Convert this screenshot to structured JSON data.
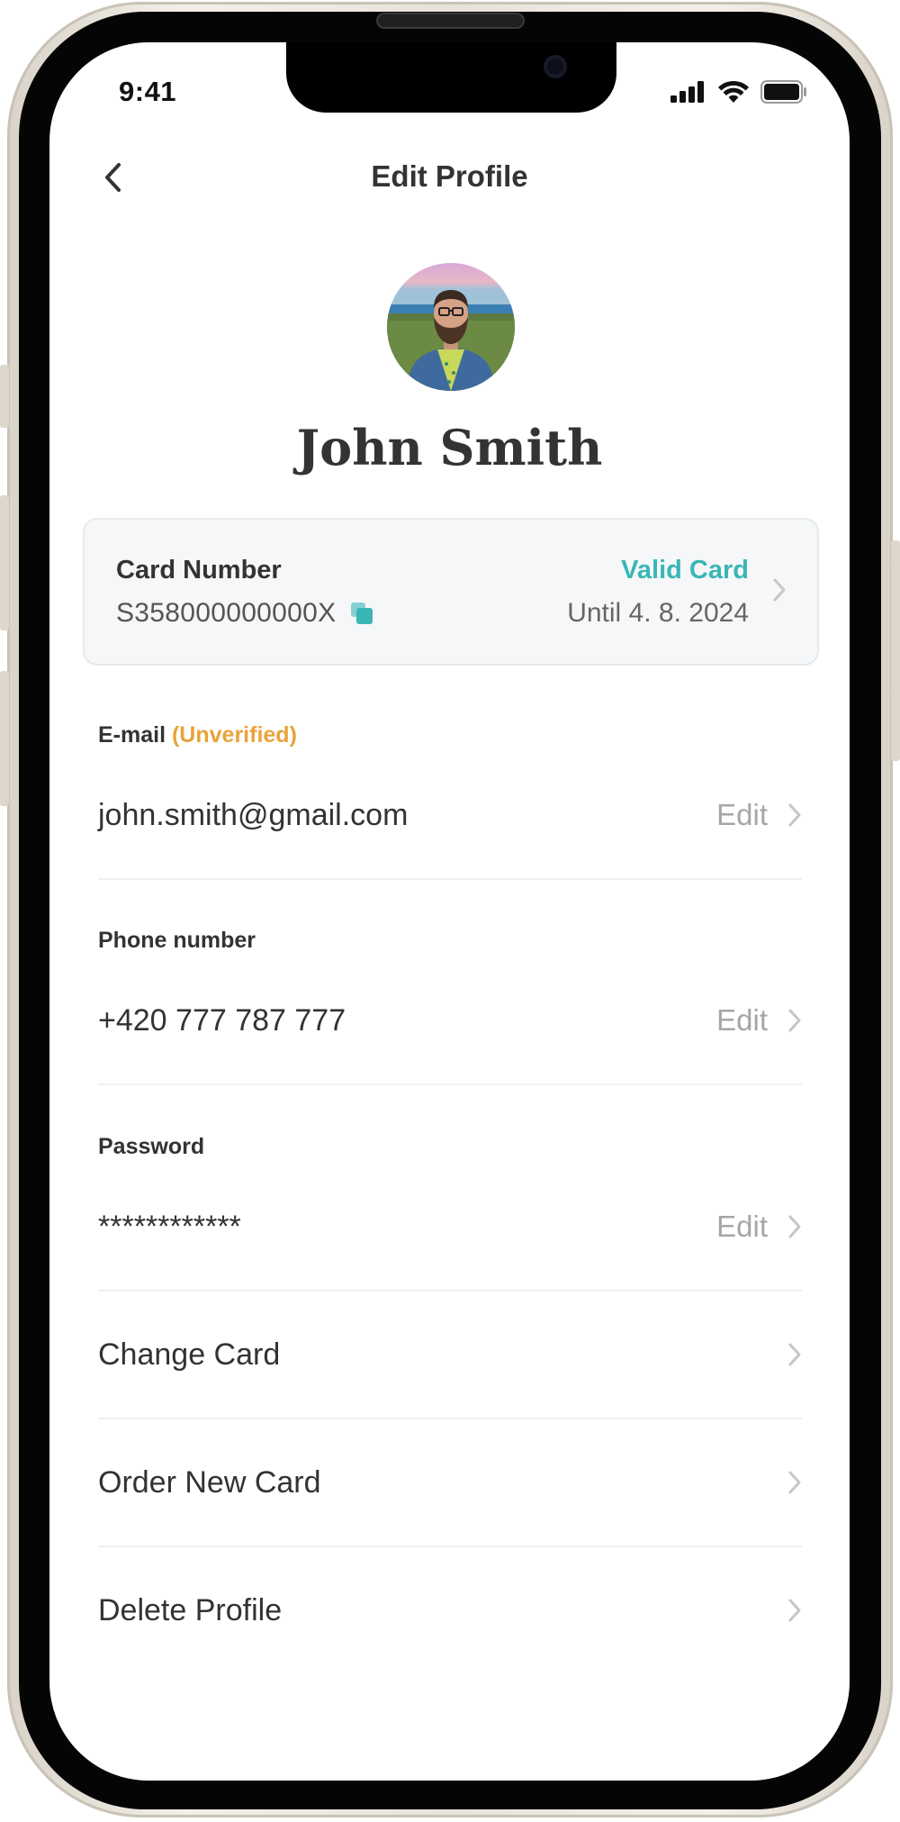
{
  "status_bar": {
    "time": "9:41"
  },
  "header": {
    "title": "Edit Profile",
    "back_icon": "chevron-left-icon"
  },
  "profile": {
    "name": "John Smith"
  },
  "card": {
    "label": "Card Number",
    "number": "S358000000000X",
    "status": "Valid Card",
    "validity": "Until 4. 8. 2024",
    "accent_color": "#3bb6b6"
  },
  "fields": {
    "email": {
      "label": "E-mail",
      "badge": "(Unverified)",
      "badge_color": "#e9a33b",
      "value": "john.smith@gmail.com",
      "action": "Edit"
    },
    "phone": {
      "label": "Phone number",
      "value": "+420 777 787 777",
      "action": "Edit"
    },
    "password": {
      "label": "Password",
      "value": "************",
      "action": "Edit"
    }
  },
  "menu": {
    "change_card": "Change Card",
    "order_new_card": "Order New Card",
    "delete_profile": "Delete Profile"
  }
}
